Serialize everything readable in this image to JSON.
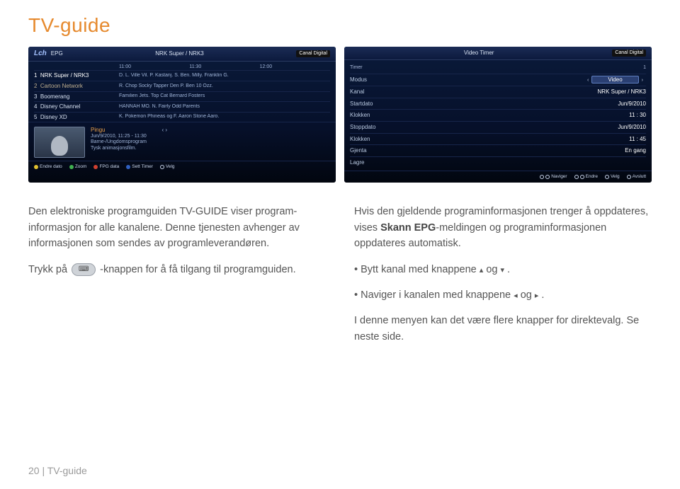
{
  "page": {
    "title": "TV-guide",
    "footer": "20  |  TV-guide"
  },
  "epg": {
    "logo": "Lch",
    "title": "EPG",
    "subheader": "NRK Super / NRK3",
    "brand": "Canal Digital",
    "timecols": [
      "11:00",
      "11:30",
      "12:00"
    ],
    "rows": [
      {
        "idx": "1",
        "ch": "NRK Super / NRK3",
        "prog": "D. L.  Ville Vil. P.  Kastanj.  S.  Ben.  Milly.  Franklin G."
      },
      {
        "idx": "2",
        "ch": "Cartoon Network",
        "prog": "R.  Chop Socky   Tapper Den P.   Ben 10   Ozz."
      },
      {
        "idx": "3",
        "ch": "Boomerang",
        "prog": "Familien Jets.   Top Cat       Bernard     Fosters"
      },
      {
        "idx": "4",
        "ch": "Disney Channel",
        "prog": "HANNAH MO.  N.        Fairly Odd Parents"
      },
      {
        "idx": "5",
        "ch": "Disney XD",
        "prog": "K.   Pokemon   Phineas og F.   Aaron Stone   Aaro."
      }
    ],
    "preview": {
      "title": "Pingu",
      "time": "Jun/9/2010, 11:25 - 11:30",
      "cat": "Barne-/Ungdomsprogram",
      "desc": "Tysk animasjonsfilm."
    },
    "footer_items": [
      "Endre dato",
      "Zoom",
      "FPG data",
      "Sett Timer",
      "Velg"
    ]
  },
  "timer": {
    "title": "Video Timer",
    "brand": "Canal Digital",
    "top": {
      "l": "Timer",
      "r": "1"
    },
    "rows": [
      {
        "l": "Modus",
        "v": "Video",
        "sel": true
      },
      {
        "l": "Kanal",
        "v": "NRK Super / NRK3"
      },
      {
        "l": "Startdato",
        "v": "Jun/9/2010"
      },
      {
        "l": "Klokken",
        "v": "11 : 30"
      },
      {
        "l": "Stoppdato",
        "v": "Jun/9/2010"
      },
      {
        "l": "Klokken",
        "v": "11 : 45"
      },
      {
        "l": "Gjenta",
        "v": "En gang"
      },
      {
        "l": "Lagre",
        "v": ""
      }
    ],
    "footer_items": [
      "Naviger",
      "Endre",
      "Velg",
      "Avslutt"
    ]
  },
  "body": {
    "left": {
      "p1": "Den elektroniske programguiden TV-GUIDE viser program­informasjon for alle kanalene. Denne tjenesten avhenger av informasjonen som sendes av programleverandøren.",
      "p2a": "Trykk på ",
      "p2b": " -knappen for å få tilgang til program­guiden."
    },
    "right": {
      "p1a": "Hvis den gjeldende programinformasjonen trenger å opp­dateres, vises ",
      "p1b": "Skann EPG",
      "p1c": "-meldingen og programinforma­sjonen oppdateres automatisk.",
      "b1a": "Bytt kanal med knappene ",
      "b1b": " og ",
      "b1c": " .",
      "b2a": "Naviger i kanalen med knappene ",
      "b2b": " og ",
      "b2c": " .",
      "p2": "I denne menyen kan det være flere knapper for direkte­valg. Se neste side."
    }
  },
  "icons": {
    "guide_button": "⌨",
    "up": "▴",
    "down": "▾",
    "left": "◂",
    "right": "▸"
  }
}
